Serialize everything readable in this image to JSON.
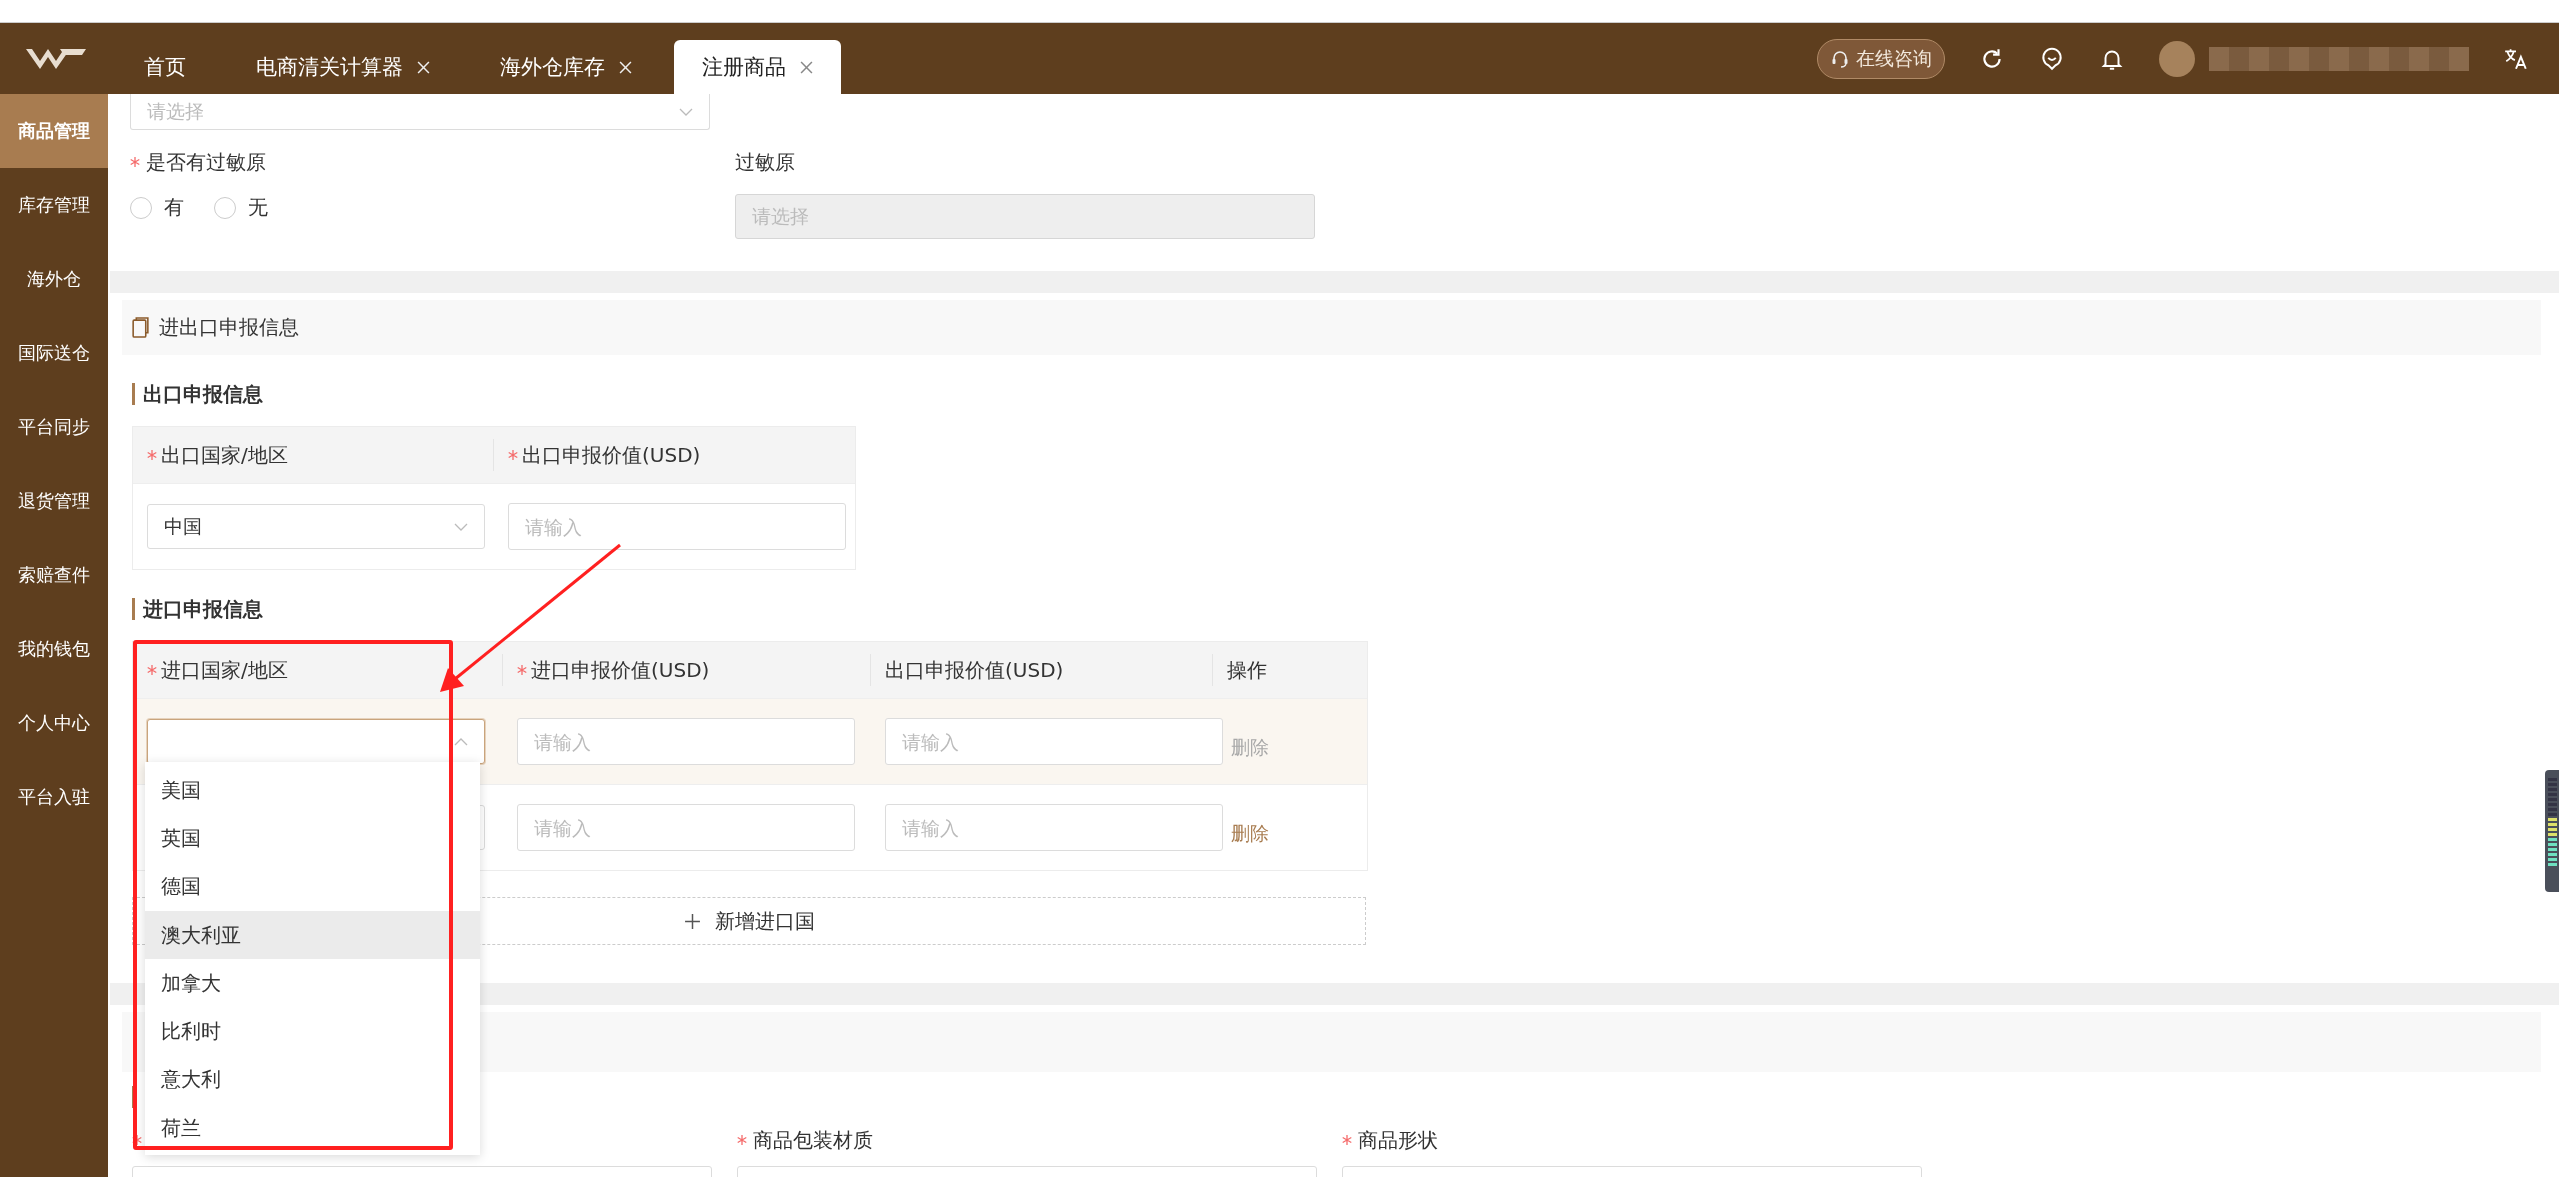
{
  "header": {
    "tabs": [
      {
        "label": "首页",
        "closable": false,
        "selected": false
      },
      {
        "label": "电商清关计算器",
        "closable": true,
        "selected": false
      },
      {
        "label": "海外仓库存",
        "closable": true,
        "selected": false
      },
      {
        "label": "注册商品",
        "closable": true,
        "selected": true
      }
    ],
    "consult_button": "在线咨询"
  },
  "sidebar": {
    "items": [
      {
        "label": "商品管理",
        "selected": true
      },
      {
        "label": "库存管理",
        "selected": false
      },
      {
        "label": "海外仓",
        "selected": false
      },
      {
        "label": "国际送仓",
        "selected": false
      },
      {
        "label": "平台同步",
        "selected": false
      },
      {
        "label": "退货管理",
        "selected": false
      },
      {
        "label": "索赔查件",
        "selected": false
      },
      {
        "label": "我的钱包",
        "selected": false
      },
      {
        "label": "个人中心",
        "selected": false
      },
      {
        "label": "平台入驻",
        "selected": false
      }
    ]
  },
  "form_top": {
    "select_placeholder": "请选择",
    "allergen_question": {
      "label": "是否有过敏原",
      "required": true,
      "options": [
        {
          "label": "有",
          "selected": false
        },
        {
          "label": "无",
          "selected": false
        }
      ]
    },
    "allergen": {
      "label": "过敏原",
      "placeholder": "请选择",
      "disabled": true
    }
  },
  "declaration": {
    "title": "进出口申报信息",
    "export": {
      "title": "出口申报信息",
      "columns": [
        {
          "label": "出口国家/地区",
          "required": true
        },
        {
          "label": "出口申报价值(USD)",
          "required": true
        }
      ],
      "rows": [
        {
          "country": "中国",
          "value_placeholder": "请输入"
        }
      ]
    },
    "import": {
      "title": "进口申报信息",
      "columns": [
        {
          "label": "进口国家/地区",
          "required": true
        },
        {
          "label": "进口申报价值(USD)",
          "required": true
        },
        {
          "label": "出口申报价值(USD)",
          "required": false
        },
        {
          "label": "操作",
          "required": false
        }
      ],
      "rows": [
        {
          "open": true,
          "highlighted": true,
          "import_placeholder": "请输入",
          "export_placeholder": "请输入",
          "action": "删除",
          "disabled": true
        },
        {
          "open": false,
          "highlighted": false,
          "import_placeholder": "请输入",
          "export_placeholder": "请输入",
          "action": "删除",
          "disabled": false
        }
      ],
      "add_button": "新增进口国",
      "dropdown": {
        "options": [
          {
            "label": "美国",
            "hovered": false
          },
          {
            "label": "英国",
            "hovered": false
          },
          {
            "label": "德国",
            "hovered": false
          },
          {
            "label": "澳大利亚",
            "hovered": true
          },
          {
            "label": "加拿大",
            "hovered": false
          },
          {
            "label": "比利时",
            "hovered": false
          },
          {
            "label": "意大利",
            "hovered": false
          },
          {
            "label": "荷兰",
            "hovered": false
          }
        ]
      }
    }
  },
  "next_section": {
    "fields": [
      {
        "required": true
      },
      {
        "label": "商品包装材质",
        "required": true
      },
      {
        "label": "商品形状",
        "required": true
      }
    ]
  }
}
